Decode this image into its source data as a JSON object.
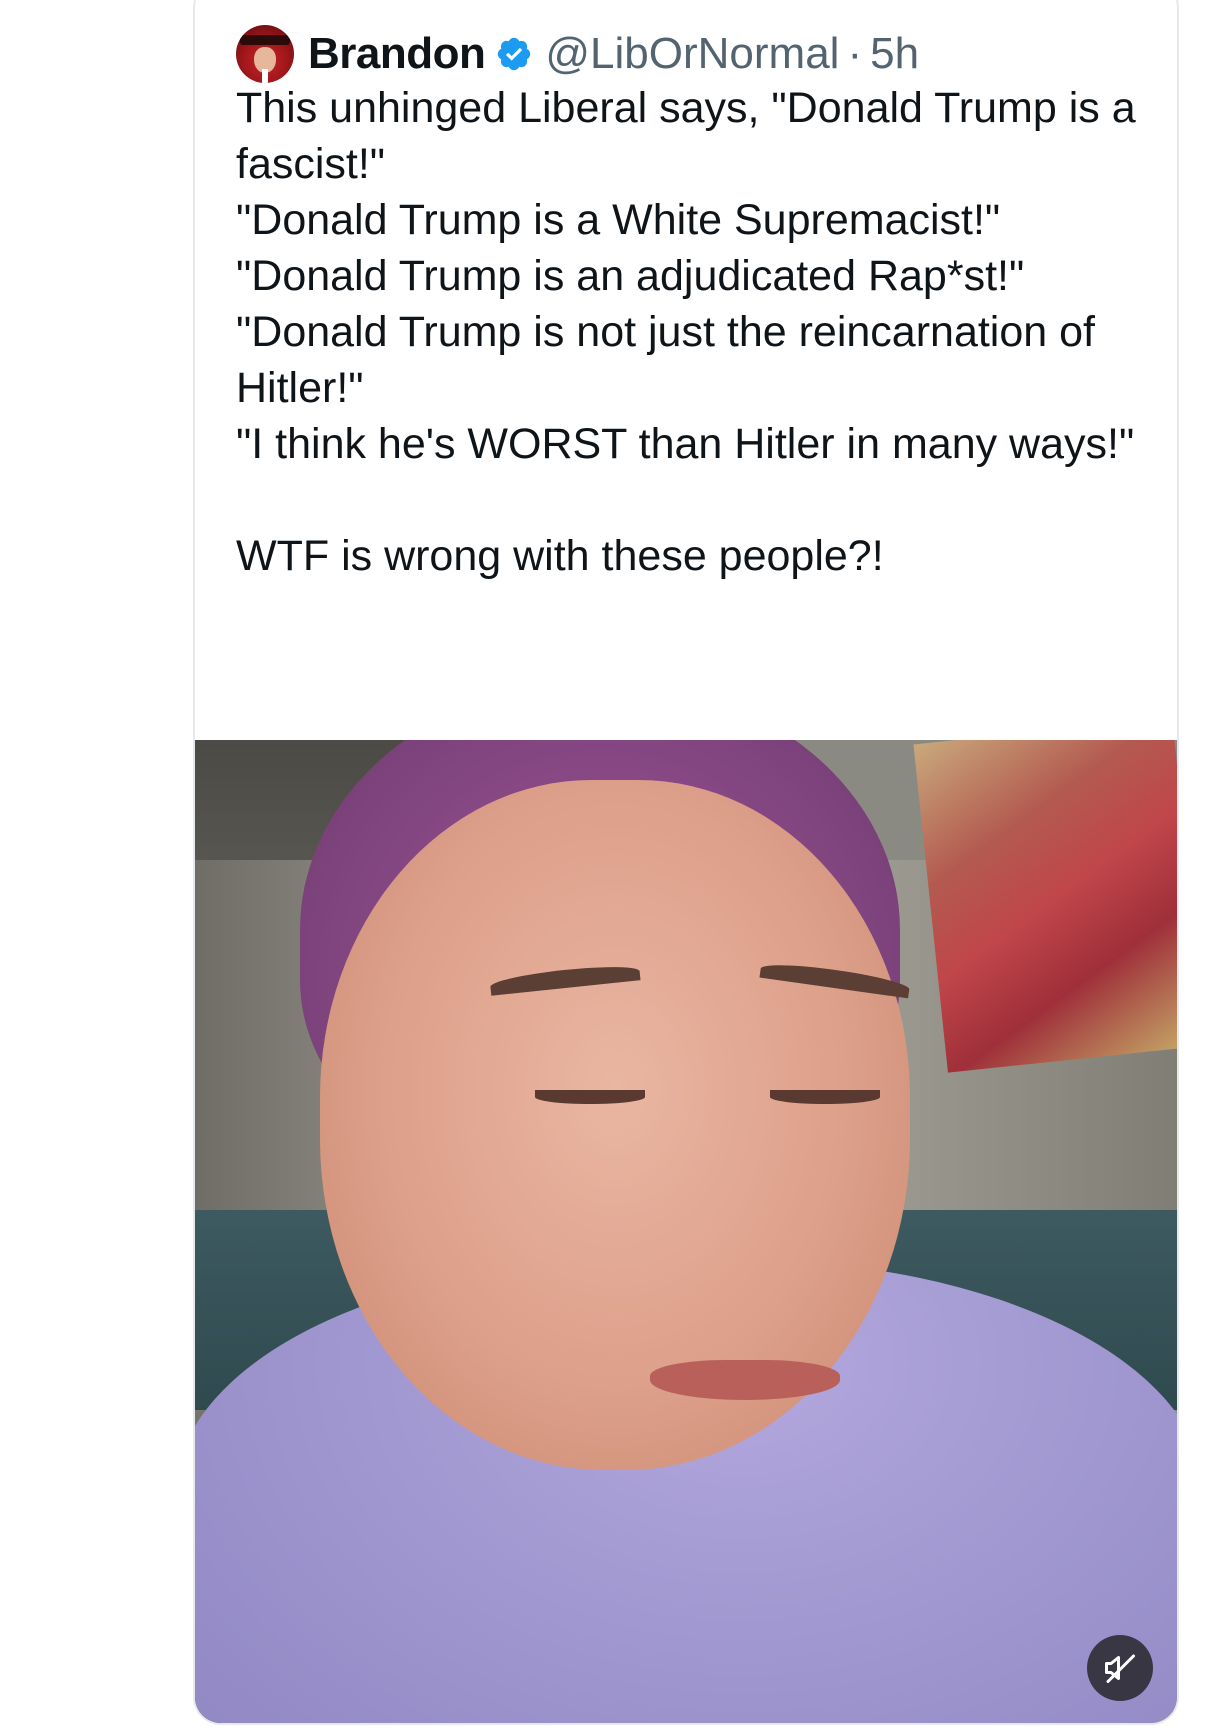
{
  "post": {
    "author": {
      "display_name": "Brandon",
      "handle": "@LibOrNormal",
      "separator": "·",
      "time": "5h",
      "verified": true,
      "avatar_icon": "avatar-red-hat"
    },
    "text": "This unhinged Liberal says, \"Donald Trump is a fascist!\"\n\"Donald Trump is a White Supremacist!\"\n\"Donald Trump is an adjudicated Rap*st!\"\n\"Donald Trump is not just the reincarnation of Hitler!\"\n\"I think he's WORST than Hitler in many ways!\"\n\nWTF is wrong with these people?!",
    "media": {
      "type": "video",
      "mute_icon": "speaker-muted-icon"
    }
  },
  "colors": {
    "text_primary": "#0f1419",
    "text_secondary": "#536471",
    "verified_blue": "#1d9bf0",
    "card_border": "#e6e9ec"
  }
}
